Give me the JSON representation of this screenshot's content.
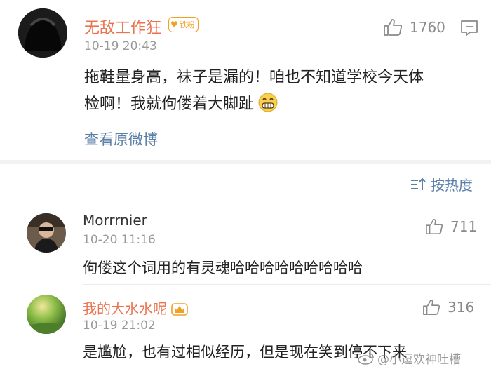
{
  "post": {
    "username": "无敌工作狂",
    "badge_label": "铁粉",
    "timestamp": "10-19 20:43",
    "like_count": "1760",
    "text_line1": "拖鞋量身高，袜子是漏的！咱也不知道学校今天体",
    "text_line2": "检啊！我就佝偻着大脚趾",
    "emoji": "grin-emoji",
    "view_original": "查看原微博"
  },
  "sort": {
    "label": "按热度",
    "icon": "sort-icon"
  },
  "comments": [
    {
      "username": "Morrrnier",
      "timestamp": "10-20 11:16",
      "like_count": "711",
      "text": "佝偻这个词用的有灵魂哈哈哈哈哈哈哈哈哈"
    },
    {
      "username": "我的大水水呢",
      "timestamp": "10-19 21:02",
      "like_count": "316",
      "text": "是尴尬，也有过相似经历，但是现在笑到停不下来"
    }
  ],
  "watermark": "@小逗欢神吐槽",
  "colors": {
    "username_orange": "#eb7350",
    "link_blue": "#5b7fa8",
    "badge_gold": "#f0a024",
    "divider_gray": "#f2f2f2"
  }
}
